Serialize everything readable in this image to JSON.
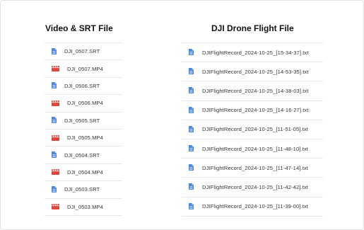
{
  "colors": {
    "doc_icon": "#4a86e8",
    "video_icon": "#e0473a",
    "divider": "#e6e6e6"
  },
  "video_srt": {
    "title": "Video & SRT File",
    "files": [
      {
        "name": "DJI_0507.SRT",
        "icon": "doc-icon"
      },
      {
        "name": "DJI_0507.MP4",
        "icon": "video-icon"
      },
      {
        "name": "DJI_0506.SRT",
        "icon": "doc-icon"
      },
      {
        "name": "DJI_0506.MP4",
        "icon": "video-icon"
      },
      {
        "name": "DJI_0505.SRT",
        "icon": "doc-icon"
      },
      {
        "name": "DJI_0505.MP4",
        "icon": "video-icon"
      },
      {
        "name": "DJI_0504.SRT",
        "icon": "doc-icon"
      },
      {
        "name": "DJI_0504.MP4",
        "icon": "video-icon"
      },
      {
        "name": "DJI_0503.SRT",
        "icon": "doc-icon"
      },
      {
        "name": "DJI_0503.MP4",
        "icon": "video-icon"
      }
    ]
  },
  "flight_records": {
    "title": "DJI Drone Flight File",
    "files": [
      {
        "name": "DJIFlightRecord_2024-10-25_[15-34-37].txt",
        "icon": "doc-icon"
      },
      {
        "name": "DJIFlightRecord_2024-10-25_[14-53-35].txt",
        "icon": "doc-icon"
      },
      {
        "name": "DJIFlightRecord_2024-10-25_[14-38-03].txt",
        "icon": "doc-icon"
      },
      {
        "name": "DJIFlightRecord_2024-10-25_[14-16-27].txt",
        "icon": "doc-icon"
      },
      {
        "name": "DJIFlightRecord_2024-10-25_[11-51-05].txt",
        "icon": "doc-icon"
      },
      {
        "name": "DJIFlightRecord_2024-10-25_[11-48-10].txt",
        "icon": "doc-icon"
      },
      {
        "name": "DJIFlightRecord_2024-10-25_[11-47-14].txt",
        "icon": "doc-icon"
      },
      {
        "name": "DJIFlightRecord_2024-10-25_[11-42-42].txt",
        "icon": "doc-icon"
      },
      {
        "name": "DJIFlightRecord_2024-10-25_[11-39-00].txt",
        "icon": "doc-icon"
      }
    ]
  }
}
